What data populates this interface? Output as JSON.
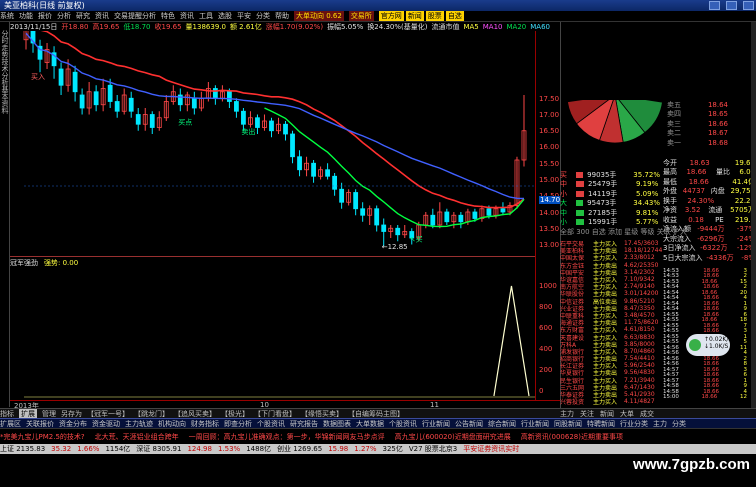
{
  "titlebar": {
    "title": "美亚柏科(日线 前复权)"
  },
  "menu": [
    "系统",
    "功能",
    "报价",
    "分析",
    "研究",
    "资讯",
    "交易提醒分析",
    "特色",
    "资讯",
    "工具",
    "选股",
    "平安",
    "分类",
    "帮助"
  ],
  "menu_tags": [
    "大单动向 0.62",
    "交易所",
    "官方网",
    "新闻",
    "股票",
    "自选"
  ],
  "infobar": {
    "a": "2013/11/15日",
    "b": "开18.80",
    "c": "高19.65",
    "d": "低18.70",
    "e": "收19.65",
    "f": "量138639.0",
    "g": "额 2.61亿",
    "h": "涨幅1.70(9.02%)",
    "i": "振幅5.05%",
    "j": "换24.30%(基量化)",
    "k": "流通市值",
    "l": "MA5",
    "m": "MA10",
    "n": "MA20",
    "o": "MA60"
  },
  "leftstrip": [
    "分",
    "时",
    "走",
    "势",
    "技",
    "术",
    "分",
    "析",
    "基",
    "本",
    "资",
    "料"
  ],
  "chart": {
    "annotations": {
      "high": "20.00",
      "low": "12.85",
      "buy1": "买入",
      "sell1": "买点",
      "buy2": "↖买",
      "mark": "卖出"
    },
    "axis": [
      "17.50",
      "17.00",
      "16.50",
      "16.00",
      "15.50",
      "15.00",
      "14.50",
      "14.00",
      "13.50",
      "13.00"
    ],
    "axis_current": "14.70",
    "sub_header": {
      "name": "冠军强劲",
      "value": "强势: 0.00"
    },
    "sub_axis": [
      "1000",
      "800",
      "600",
      "400",
      "200",
      "0"
    ],
    "bottom_dates": [
      "2013年",
      "10",
      "11"
    ]
  },
  "tabs": [
    "指标",
    "扩展",
    "管理",
    "另存为",
    "【冠军一号】",
    "【跳龙门】",
    "【追风买卖】",
    "【极光】",
    "【下门看盘】",
    "【缘悟买卖】",
    "【自编筹码主图】"
  ],
  "func": [
    "扩展区",
    "关联报价",
    "资金分布",
    "资金驱动",
    "主力轨迹",
    "机构动向",
    "财务指标",
    "即查分析",
    "个股资讯",
    "研究报告",
    "数据图表",
    "大单数据",
    "个股资讯",
    "行业新闻",
    "公告新闻",
    "综合新闻",
    "行业新闻",
    "同股新闻",
    "特聘新闻",
    "行业分类",
    "主力",
    "分类"
  ],
  "news": [
    "*完美九宝儿PM2.5的技术?",
    "北大荒、天涯铝业组合跨年",
    "一周回顾：高九宝儿准确观点：第一步，华锦新闻网友马步点评",
    "高九宝儿(600020)近期盘面研究进展",
    "高新资讯(000628)近期重要事项"
  ],
  "status": [
    "上证 2135.83",
    "35.32",
    "1.66%",
    "1154亿",
    "深证 8305.91",
    "124.98",
    "1.53%",
    "1488亿",
    "创业 1269.65",
    "15.98",
    "1.27%",
    "325亿",
    "V27 股票北京3",
    "平安证券资讯实时"
  ],
  "watermark": "www.7gpzb.com",
  "prices": [
    {
      "lbl": "卖五",
      "p": "18.64",
      "v": "",
      "c": "red"
    },
    {
      "lbl": "卖四",
      "p": "18.65",
      "v": "",
      "c": "red"
    },
    {
      "lbl": "卖三",
      "p": "18.66",
      "v": "",
      "c": "red"
    },
    {
      "lbl": "卖二",
      "p": "18.67",
      "v": "",
      "c": "red"
    },
    {
      "lbl": "卖一",
      "p": "18.68",
      "v": "",
      "c": "red"
    },
    {
      "lbl": "",
      "p": "",
      "v": "",
      "c": "red"
    }
  ],
  "summary": [
    {
      "k": "今开",
      "v": "18.63",
      "k2": "",
      "v2": "19.65"
    },
    {
      "k": "最高",
      "v": "18.66",
      "k2": "量比",
      "v2": "6.07"
    },
    {
      "k": "最低",
      "v": "18.66",
      "k2": "",
      "v2": "41.4亿"
    },
    {
      "k": "外盘",
      "v": "44737",
      "k2": "内盘",
      "v2": "29,750"
    },
    {
      "k": "换手",
      "v": "24.30%",
      "k2": "",
      "v2": "22.20"
    },
    {
      "k": "净资",
      "v": "3.52",
      "k2": "流通",
      "v2": "5705万"
    },
    {
      "k": "收益",
      "v": "0.18",
      "k2": "PE",
      "v2": "219.2"
    },
    {
      "k": "净流入额",
      "v": "-9444万",
      "k2": "",
      "v2": "-37%"
    },
    {
      "k": "大宗流入",
      "v": "-6296万",
      "k2": "",
      "v2": "-24%"
    },
    {
      "k": "3日净流入",
      "v": "-6322万",
      "k2": "",
      "v2": "-12%"
    },
    {
      "k": "5日大宗流入",
      "v": "-4336万",
      "k2": "",
      "v2": "-8%"
    }
  ],
  "buysell": [
    {
      "k": "买",
      "v": "99035手",
      "p": "35.72%"
    },
    {
      "k": "中",
      "v": "25479手",
      "p": "9.19%"
    },
    {
      "k": "小",
      "v": "14119手",
      "p": "5.09%"
    },
    {
      "k": "大",
      "v": "95473手",
      "p": "34.43%"
    },
    {
      "k": "中",
      "v": "27185手",
      "p": "9.81%"
    },
    {
      "k": "小",
      "v": "15991手",
      "p": "5.77%"
    }
  ],
  "buysell_footer": "全部 300  自选  添加  星级  等级  关联  扩大",
  "trades": [
    {
      "n": "石平交易",
      "a": "主力买入",
      "v": "17.45/3603"
    },
    {
      "n": "美亚柏科",
      "a": "主力卖出",
      "v": "18.18/12744"
    },
    {
      "n": "中国太保",
      "a": "主力买入",
      "v": "2.33/8012"
    },
    {
      "n": "东方金钰",
      "a": "主力卖出",
      "v": "4.62/25350"
    },
    {
      "n": "中国平安",
      "a": "主力卖出",
      "v": "3.14/2302"
    },
    {
      "n": "华谊嘉信",
      "a": "主力买入",
      "v": "7.10/9342"
    },
    {
      "n": "南方航空",
      "a": "主力买入",
      "v": "2.74/9140"
    },
    {
      "n": "华联股份",
      "a": "主力卖出",
      "v": "3.01/14200"
    },
    {
      "n": "中信证券",
      "a": "高位卖出",
      "v": "9.86/5210"
    },
    {
      "n": "兴业证券",
      "a": "主力卖出",
      "v": "8.47/3350"
    },
    {
      "n": "中联重科",
      "a": "主力买入",
      "v": "3.48/4570"
    },
    {
      "n": "海通证券",
      "a": "主力卖出",
      "v": "11.75/8620"
    },
    {
      "n": "东方财富",
      "a": "主力买入",
      "v": "4.61/8150"
    },
    {
      "n": "天喜建设",
      "a": "主力买入",
      "v": "6.63/8830"
    },
    {
      "n": "万科A",
      "a": "主力卖出",
      "v": "3.85/8000"
    },
    {
      "n": "浦发银行",
      "a": "主力买入",
      "v": "8.70/4860"
    },
    {
      "n": "招商银行",
      "a": "主力卖出",
      "v": "7.54/4410"
    },
    {
      "n": "长江证券",
      "a": "主力买入",
      "v": "5.96/2540"
    },
    {
      "n": "华夏银行",
      "a": "主力卖出",
      "v": "9.56/4830"
    },
    {
      "n": "民生银行",
      "a": "主力买入",
      "v": "7.21/3940"
    },
    {
      "n": "三六五网",
      "a": "主力卖出",
      "v": "6.47/1430"
    },
    {
      "n": "华泰证券",
      "a": "主力卖出",
      "v": "5.41/2930"
    },
    {
      "n": "兴蓉投资",
      "a": "主力买入",
      "v": "4.11/4827"
    }
  ],
  "ticks": [
    {
      "t": "14:53",
      "p": "18.66",
      "v": "3",
      "c": "red"
    },
    {
      "t": "14:53",
      "p": "18.66",
      "v": "2",
      "c": "red"
    },
    {
      "t": "14:53",
      "p": "18.66",
      "v": "15",
      "c": "red"
    },
    {
      "t": "14:54",
      "p": "18.66",
      "v": "2",
      "c": "red"
    },
    {
      "t": "14:54",
      "p": "18.66",
      "v": "20",
      "c": "red"
    },
    {
      "t": "14:54",
      "p": "18.66",
      "v": "4",
      "c": "red"
    },
    {
      "t": "14:54",
      "p": "18.66",
      "v": "1",
      "c": "red"
    },
    {
      "t": "14:54",
      "p": "18.66",
      "v": "9",
      "c": "red"
    },
    {
      "t": "14:55",
      "p": "18.66",
      "v": "6",
      "c": "red"
    },
    {
      "t": "14:55",
      "p": "18.66",
      "v": "18",
      "c": "red"
    },
    {
      "t": "14:55",
      "p": "18.66",
      "v": "7",
      "c": "red"
    },
    {
      "t": "14:55",
      "p": "18.66",
      "v": "3",
      "c": "red"
    },
    {
      "t": "14:55",
      "p": "18.66",
      "v": "1",
      "c": "red"
    },
    {
      "t": "14:55",
      "p": "18.66",
      "v": "5",
      "c": "red"
    },
    {
      "t": "14:56",
      "p": "18.66",
      "v": "11",
      "c": "red"
    },
    {
      "t": "14:56",
      "p": "18.66",
      "v": "4",
      "c": "red"
    },
    {
      "t": "14:56",
      "p": "18.66",
      "v": "2",
      "c": "red"
    },
    {
      "t": "14:56",
      "p": "18.66",
      "v": "8",
      "c": "red"
    },
    {
      "t": "14:57",
      "p": "18.66",
      "v": "3",
      "c": "red"
    },
    {
      "t": "14:57",
      "p": "18.66",
      "v": "6",
      "c": "red"
    },
    {
      "t": "14:57",
      "p": "18.66",
      "v": "1",
      "c": "red"
    },
    {
      "t": "14:58",
      "p": "18.66",
      "v": "9",
      "c": "red"
    },
    {
      "t": "14:58",
      "p": "18.66",
      "v": "4",
      "c": "red"
    },
    {
      "t": "15:00",
      "p": "18.66",
      "v": "12",
      "c": "red"
    }
  ],
  "speed": {
    "up": "0.02K/S",
    "down": "1.0K/S"
  },
  "tabs2": [
    "主力",
    "关注",
    "新闻",
    "大单",
    "成交"
  ],
  "colors": {
    "up": "#ff4848",
    "down": "#00e050",
    "ma5": "#ffffff",
    "ma10": "#ffff40",
    "ma20": "#ff3030",
    "ma60": "#4060ff",
    "ma_green": "#00ff40"
  }
}
